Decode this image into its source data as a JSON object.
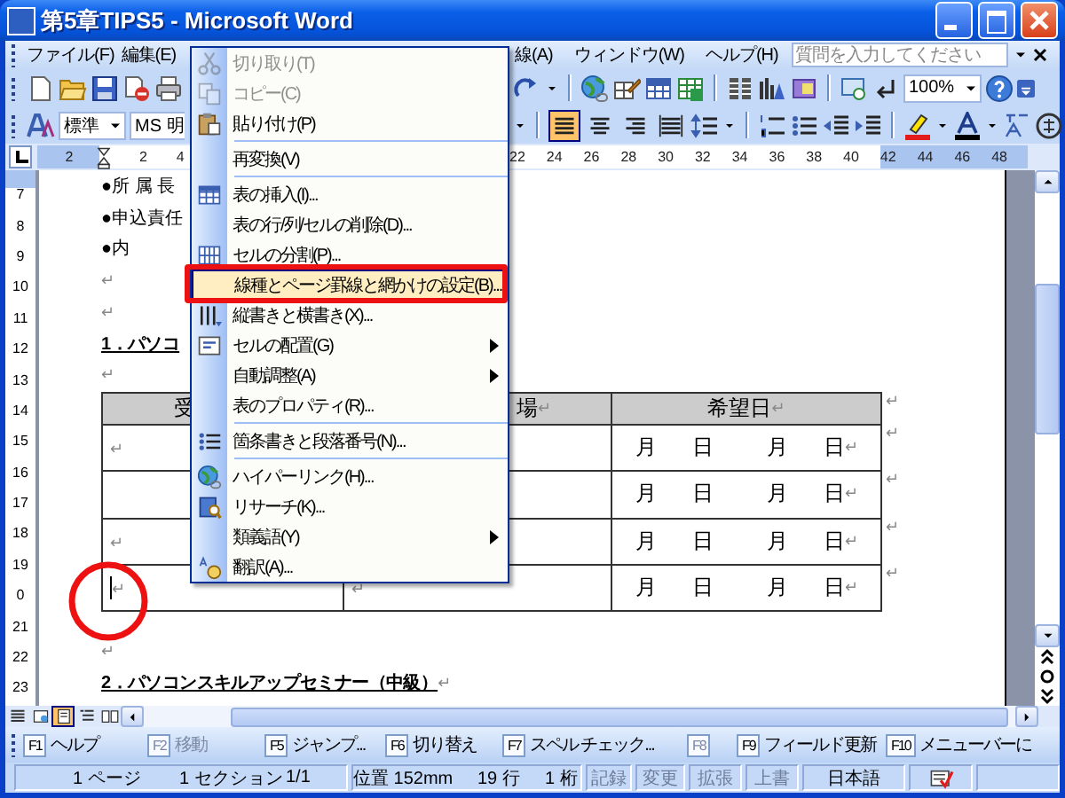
{
  "window": {
    "title": "第5章TIPS5 - Microsoft Word"
  },
  "menu_bar": {
    "items": [
      {
        "label": "ファイル(F)"
      },
      {
        "label": "編集(E)"
      },
      {
        "label": "線(A)"
      },
      {
        "label": "ウィンドウ(W)"
      },
      {
        "label": "ヘルプ(H)"
      }
    ],
    "help_box": {
      "placeholder": "質問を入力してください"
    }
  },
  "standard_toolbar": {
    "zoom": "100%"
  },
  "formatting_toolbar": {
    "style": "標準",
    "font": "MS 明",
    "alignment_buttons": [
      {
        "selected": true
      },
      {
        "selected": false
      },
      {
        "selected": false
      },
      {
        "selected": false
      }
    ]
  },
  "ruler": {
    "left_numbers": [
      "2",
      "2",
      "4"
    ],
    "right_numbers": [
      "22",
      "24",
      "26",
      "28",
      "30",
      "32",
      "34",
      "36",
      "38",
      "40",
      "42",
      "44",
      "46",
      "48"
    ]
  },
  "vertical_ruler": {
    "numbers": [
      "7",
      "8",
      "9",
      "10",
      "11",
      "12",
      "13",
      "14",
      "15",
      "16",
      "17",
      "18",
      "19",
      "0",
      "21",
      "22",
      "23"
    ]
  },
  "document": {
    "paragraphs_before": [
      {
        "kind": "text",
        "text": "●所 属 長"
      },
      {
        "kind": "text",
        "text": "●申込責任"
      },
      {
        "kind": "text",
        "text": "●内"
      },
      {
        "kind": "mark",
        "text": "↵"
      },
      {
        "kind": "mark",
        "text": "↵"
      },
      {
        "kind": "heading",
        "text": "1．パソコ"
      },
      {
        "kind": "mark",
        "text": "↵"
      }
    ],
    "table": {
      "header": [
        {
          "text": "受"
        },
        {
          "text": "場",
          "mark": "↵"
        },
        {
          "text": "希望日",
          "mark": "↵"
        }
      ],
      "header_end_mark": "↵",
      "rows": [
        {
          "cells": [
            {
              "mark": "↵",
              "cursor": false
            },
            {},
            {
              "dates": [
                "月",
                "日",
                "月",
                "日"
              ],
              "mark": "↵"
            }
          ],
          "end_mark": "↵"
        },
        {
          "cells": [
            {
              "cursor": false
            },
            {},
            {
              "dates": [
                "月",
                "日",
                "月",
                "日"
              ],
              "mark": "↵"
            }
          ],
          "end_mark": "↵"
        },
        {
          "cells": [
            {
              "mark": "↵",
              "cursor": false
            },
            {},
            {
              "dates": [
                "月",
                "日",
                "月",
                "日"
              ],
              "mark": "↵"
            }
          ],
          "end_mark": "↵"
        },
        {
          "cells": [
            {
              "mark": "↵",
              "cursor": true
            },
            {
              "mark": "↵"
            },
            {
              "dates": [
                "月",
                "日",
                "月",
                "日"
              ],
              "mark": "↵"
            }
          ],
          "end_mark": "↵"
        }
      ]
    },
    "paragraphs_after": [
      {
        "kind": "mark",
        "text": "↵"
      },
      {
        "kind": "heading",
        "text": "2．パソコンスキルアップセミナー（中級）",
        "mark": "↵"
      }
    ]
  },
  "view_buttons": [
    {
      "selected": false
    },
    {
      "selected": false
    },
    {
      "selected": true
    },
    {
      "selected": false
    },
    {
      "selected": false
    }
  ],
  "context_menu": {
    "items": [
      {
        "kind": "item",
        "label": "切り取り(T)",
        "disabled": true,
        "selected": false,
        "submenu": false
      },
      {
        "kind": "item",
        "label": "コピー(C)",
        "disabled": true,
        "selected": false,
        "submenu": false
      },
      {
        "kind": "item",
        "label": "貼り付け(P)",
        "disabled": false,
        "selected": false,
        "submenu": false
      },
      {
        "kind": "separator"
      },
      {
        "kind": "item",
        "label": "再変換(V)",
        "disabled": false,
        "selected": false,
        "submenu": false
      },
      {
        "kind": "separator"
      },
      {
        "kind": "item",
        "label": "表の挿入(I)...",
        "disabled": false,
        "selected": false,
        "submenu": false
      },
      {
        "kind": "item",
        "label": "表の行/列/セルの削除(D)...",
        "disabled": false,
        "selected": false,
        "submenu": false
      },
      {
        "kind": "item",
        "label": "セルの分割(P)...",
        "disabled": false,
        "selected": false,
        "submenu": false
      },
      {
        "kind": "item",
        "label": "線種とページ罫線と網かけの設定(B)...",
        "disabled": false,
        "selected": true,
        "submenu": false
      },
      {
        "kind": "item",
        "label": "縦書きと横書き(X)...",
        "disabled": false,
        "selected": false,
        "submenu": false
      },
      {
        "kind": "item",
        "label": "セルの配置(G)",
        "disabled": false,
        "selected": false,
        "submenu": true
      },
      {
        "kind": "item",
        "label": "自動調整(A)",
        "disabled": false,
        "selected": false,
        "submenu": true
      },
      {
        "kind": "item",
        "label": "表のプロパティ(R)...",
        "disabled": false,
        "selected": false,
        "submenu": false
      },
      {
        "kind": "separator"
      },
      {
        "kind": "item",
        "label": "箇条書きと段落番号(N)...",
        "disabled": false,
        "selected": false,
        "submenu": false
      },
      {
        "kind": "separator"
      },
      {
        "kind": "item",
        "label": "ハイパーリンク(H)...",
        "disabled": false,
        "selected": false,
        "submenu": false
      },
      {
        "kind": "item",
        "label": "リサーチ(K)...",
        "disabled": false,
        "selected": false,
        "submenu": false
      },
      {
        "kind": "item",
        "label": "類義語(Y)",
        "disabled": false,
        "selected": false,
        "submenu": true
      },
      {
        "kind": "item",
        "label": "翻訳(A)...",
        "disabled": false,
        "selected": false,
        "submenu": false
      }
    ]
  },
  "function_keys": [
    {
      "key": "F1",
      "label": "ヘルプ",
      "disabled": false
    },
    {
      "key": "F2",
      "label": "移動",
      "disabled": true
    },
    {
      "key": "F5",
      "label": "ジャンプ...",
      "disabled": false
    },
    {
      "key": "F6",
      "label": "切り替え",
      "disabled": false
    },
    {
      "key": "F7",
      "label": "スペル チェック...",
      "disabled": false
    },
    {
      "key": "F8",
      "disabled": true
    },
    {
      "key": "F9",
      "label": "フィールド更新",
      "disabled": false
    },
    {
      "key": "F10",
      "label": "メニューバーに",
      "disabled": false
    }
  ],
  "status_bar": {
    "items": [
      {
        "text": "1 ページ",
        "disabled": false
      },
      {
        "text": "1 セクション",
        "disabled": false
      },
      {
        "text": "1/1",
        "disabled": false
      },
      {
        "text": "位置 152mm",
        "disabled": false
      },
      {
        "text": "19 行",
        "disabled": false
      },
      {
        "text": "1 桁",
        "disabled": false
      },
      {
        "text": "記録",
        "disabled": true
      },
      {
        "text": "変更",
        "disabled": true
      },
      {
        "text": "拡張",
        "disabled": true
      },
      {
        "text": "上書",
        "disabled": true
      },
      {
        "text": "日本語",
        "disabled": false
      }
    ]
  }
}
